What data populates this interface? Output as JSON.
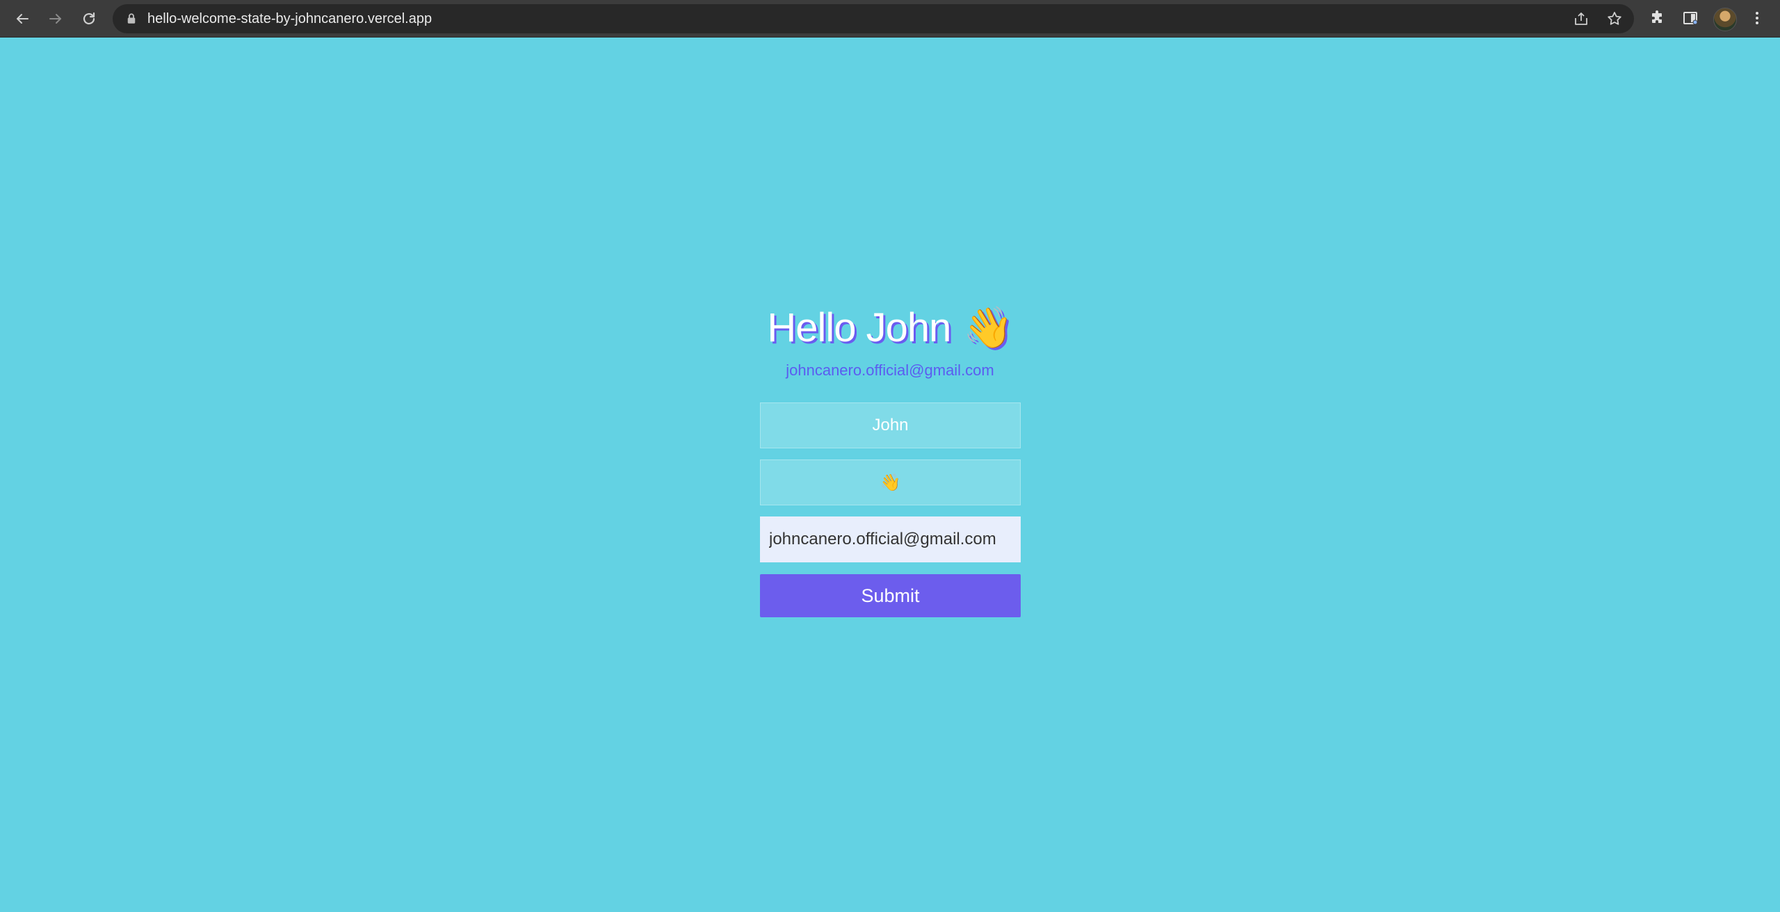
{
  "browser": {
    "url": "hello-welcome-state-by-johncanero.vercel.app",
    "icons": {
      "back": "arrow-left-icon",
      "forward": "arrow-right-icon",
      "reload": "reload-icon",
      "lock": "lock-icon",
      "share": "share-icon",
      "bookmark": "star-icon",
      "extensions": "puzzle-icon",
      "side_panel": "side-panel-icon",
      "menu": "kebab-menu-icon"
    }
  },
  "page": {
    "greeting_name": "Hello John",
    "greeting_emoji": "👋",
    "email_display": "johncanero.official@gmail.com",
    "form": {
      "name_value": "John",
      "emoji_value": "👋",
      "email_value": "johncanero.official@gmail.com",
      "submit_label": "Submit"
    },
    "colors": {
      "background": "#63d2e3",
      "accent": "#6c5ded",
      "email_text": "#5b5cf0",
      "heading_text": "#ffffff"
    }
  }
}
